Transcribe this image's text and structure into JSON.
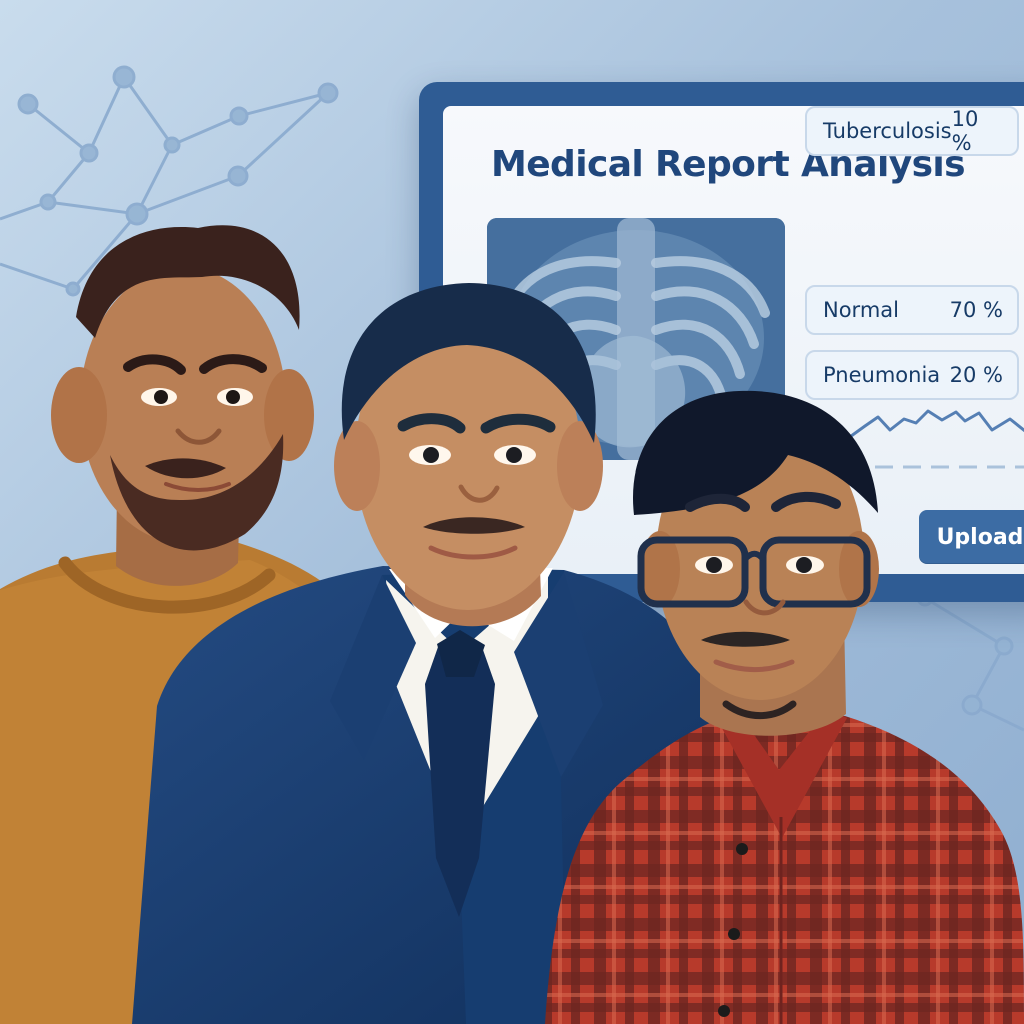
{
  "report": {
    "title": "Medical Report Analysis",
    "results": [
      {
        "label": "Normal",
        "value": "70 %"
      },
      {
        "label": "Pneumonia",
        "value": "20 %"
      },
      {
        "label": "Tuberculosis",
        "value": "10 %"
      }
    ],
    "upload_label": "Upload"
  },
  "icons": {
    "network": "network-dots-icon",
    "xray": "chest-xray-icon",
    "sparkline": "trend-line-icon"
  },
  "colors": {
    "background": "#dbe8f4",
    "monitor_frame": "#2f5c94",
    "screen": "#f4f7fb",
    "accent": "#3c6ca4",
    "title": "#20477c"
  }
}
